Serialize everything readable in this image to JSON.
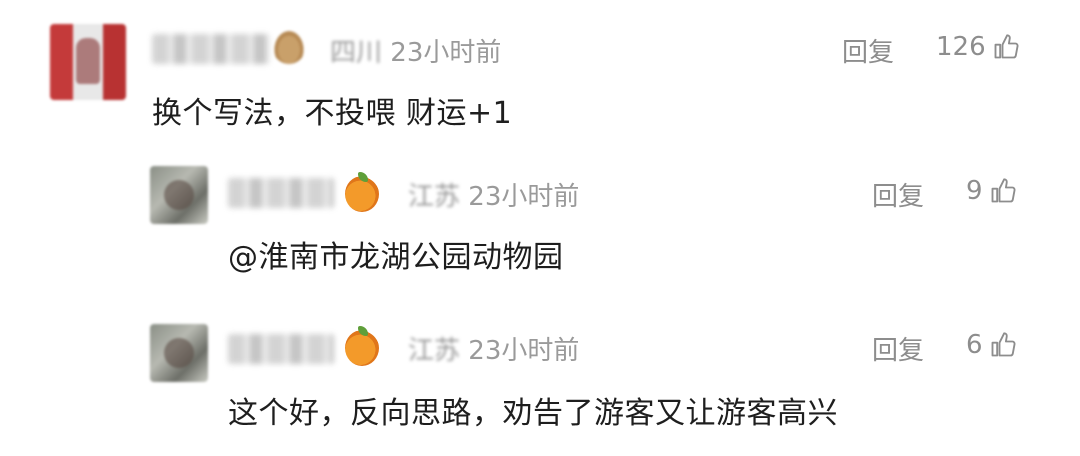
{
  "comments": [
    {
      "location": "四川",
      "time": "23小时前",
      "reply_label": "回复",
      "likes": "126",
      "content": "换个写法，不投喂 财运+1",
      "avatar_icon": "avatar-image",
      "badge_icon": "dog-emoji-icon"
    },
    {
      "location": "江苏",
      "time": "23小时前",
      "reply_label": "回复",
      "likes": "9",
      "content": "@淮南市龙湖公园动物园",
      "avatar_icon": "avatar-image",
      "badge_icon": "orange-emoji-icon"
    },
    {
      "location": "江苏",
      "time": "23小时前",
      "reply_label": "回复",
      "likes": "6",
      "content": "这个好，反向思路，劝告了游客又让游客高兴",
      "avatar_icon": "avatar-image",
      "badge_icon": "orange-emoji-icon"
    }
  ],
  "colors": {
    "meta_text": "#9a9a9a",
    "action_text": "#8d8d8d",
    "content_text": "#1e1e1e"
  }
}
